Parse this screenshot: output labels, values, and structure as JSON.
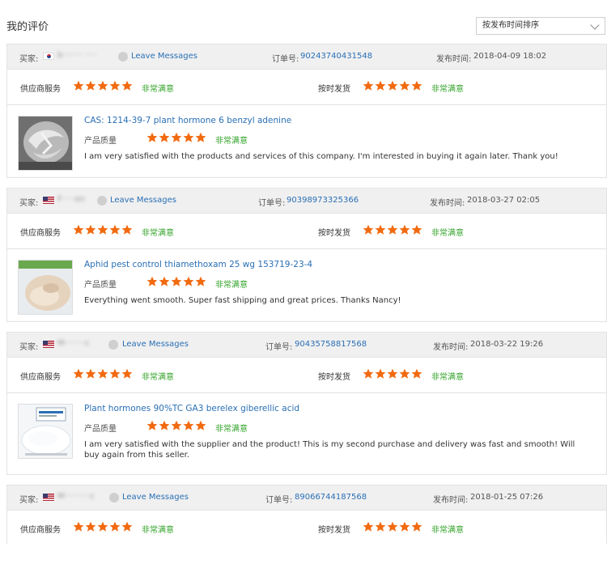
{
  "page": {
    "title": "我的评价",
    "sort_label": "按发布时间排序"
  },
  "labels": {
    "buyer": "买家:",
    "leave_messages": "Leave Messages",
    "order_no": "订单号:",
    "posted": "发布时间:",
    "supplier_service": "供应商服务",
    "on_time": "按时发货",
    "product_quality": "产品质量",
    "very_satisfied": "非常满意"
  },
  "colors": {
    "star": "#f26a10",
    "link": "#2a6fb5",
    "satisfied": "#33a329",
    "header_bg": "#f0f0f0"
  },
  "reviews": [
    {
      "flag": "kr",
      "buyer_name": "b········ ····",
      "order_no": "90243740431548",
      "time": "2018-04-09 18:02",
      "supplier_stars": 5,
      "ontime_stars": 5,
      "product_stars": 5,
      "product_title": "CAS: 1214-39-7 plant hormone 6 benzyl adenine",
      "thumb": "foil",
      "comment": "I am very satisfied with the products and services of this company. I'm interested in buying it again later. Thank you!"
    },
    {
      "flag": "us",
      "buyer_name": "F·····en",
      "order_no": "90398973325366",
      "time": "2018-03-27 02:05",
      "supplier_stars": 5,
      "ontime_stars": 5,
      "product_stars": 5,
      "product_title": "Aphid pest control thiamethoxam 25 wg 153719-23-4",
      "thumb": "powder",
      "comment": "Everything went smooth. Super fast shipping and great prices. Thanks Nancy!"
    },
    {
      "flag": "us",
      "buyer_name": "M········c",
      "order_no": "90435758817568",
      "time": "2018-03-22 19:26",
      "supplier_stars": 5,
      "ontime_stars": 5,
      "product_stars": 5,
      "product_title": "Plant hormones 90%TC GA3 berelex giberellic acid",
      "thumb": "white",
      "comment": "I am very satisfied with the supplier and the product! This is my second purchase and delivery was fast and smooth! Will buy again from this seller."
    },
    {
      "flag": "us",
      "buyer_name": "M··········c",
      "order_no": "89066744187568",
      "time": "2018-01-25 07:26",
      "supplier_stars": 5,
      "ontime_stars": 5
    }
  ]
}
